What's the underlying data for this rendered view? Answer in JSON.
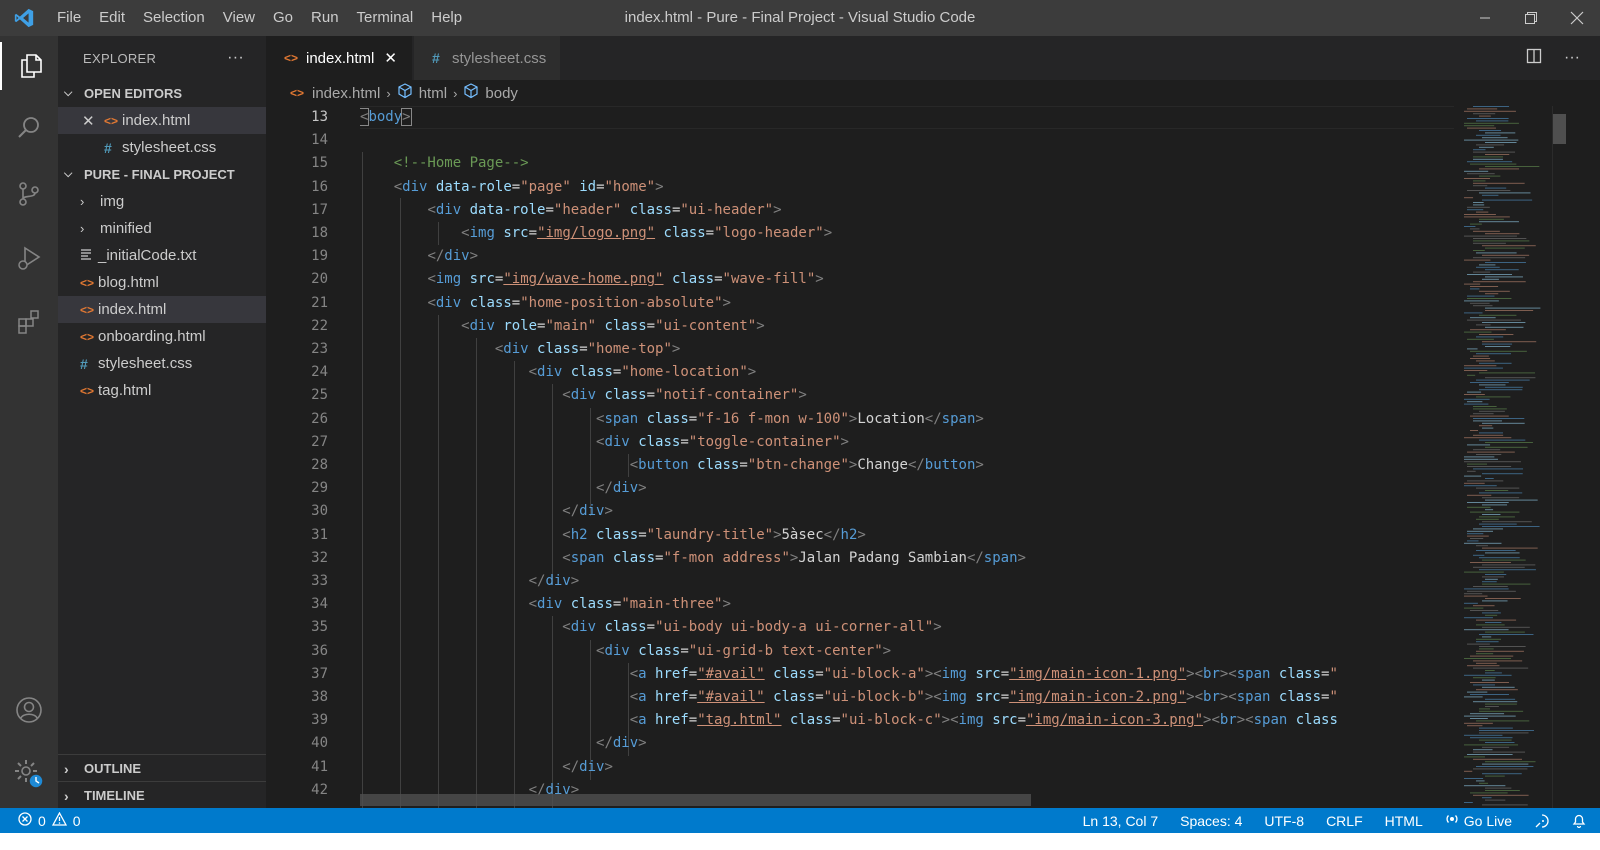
{
  "window": {
    "title": "index.html - Pure - Final Project - Visual Studio Code",
    "menu": [
      "File",
      "Edit",
      "Selection",
      "View",
      "Go",
      "Run",
      "Terminal",
      "Help"
    ]
  },
  "sidebar": {
    "header": "EXPLORER",
    "more": "···",
    "open_editors": {
      "title": "OPEN EDITORS",
      "items": [
        {
          "name": "index.html",
          "type": "html"
        },
        {
          "name": "stylesheet.css",
          "type": "css"
        }
      ]
    },
    "project": {
      "title": "PURE - FINAL PROJECT",
      "folders": [
        "img",
        "minified"
      ],
      "files": [
        {
          "name": "_initialCode.txt",
          "type": "txt"
        },
        {
          "name": "blog.html",
          "type": "html"
        },
        {
          "name": "index.html",
          "type": "html"
        },
        {
          "name": "onboarding.html",
          "type": "html"
        },
        {
          "name": "stylesheet.css",
          "type": "css"
        },
        {
          "name": "tag.html",
          "type": "html"
        }
      ]
    },
    "outline": "OUTLINE",
    "timeline": "TIMELINE"
  },
  "tabs": [
    {
      "label": "index.html",
      "type": "html",
      "active": true
    },
    {
      "label": "stylesheet.css",
      "type": "css",
      "active": false
    }
  ],
  "breadcrumb": [
    "index.html",
    "html",
    "body"
  ],
  "editor": {
    "line_numbers": [
      "13",
      "14",
      "15",
      "16",
      "17",
      "18",
      "19",
      "20",
      "21",
      "22",
      "23",
      "24",
      "25",
      "26",
      "27",
      "28",
      "29",
      "30",
      "31",
      "32",
      "33",
      "34",
      "35",
      "36",
      "37",
      "38",
      "39",
      "40",
      "41",
      "42"
    ]
  },
  "statusbar": {
    "errors": "0",
    "warnings": "0",
    "position": "Ln 13, Col 7",
    "spaces": "Spaces: 4",
    "encoding": "UTF-8",
    "eol": "CRLF",
    "language": "HTML",
    "golive": "Go Live"
  },
  "colors": {
    "statusbar": "#007acc",
    "tag": "#569cd6",
    "attribute": "#9cdcfe",
    "string": "#ce9178",
    "comment": "#6a9955"
  }
}
